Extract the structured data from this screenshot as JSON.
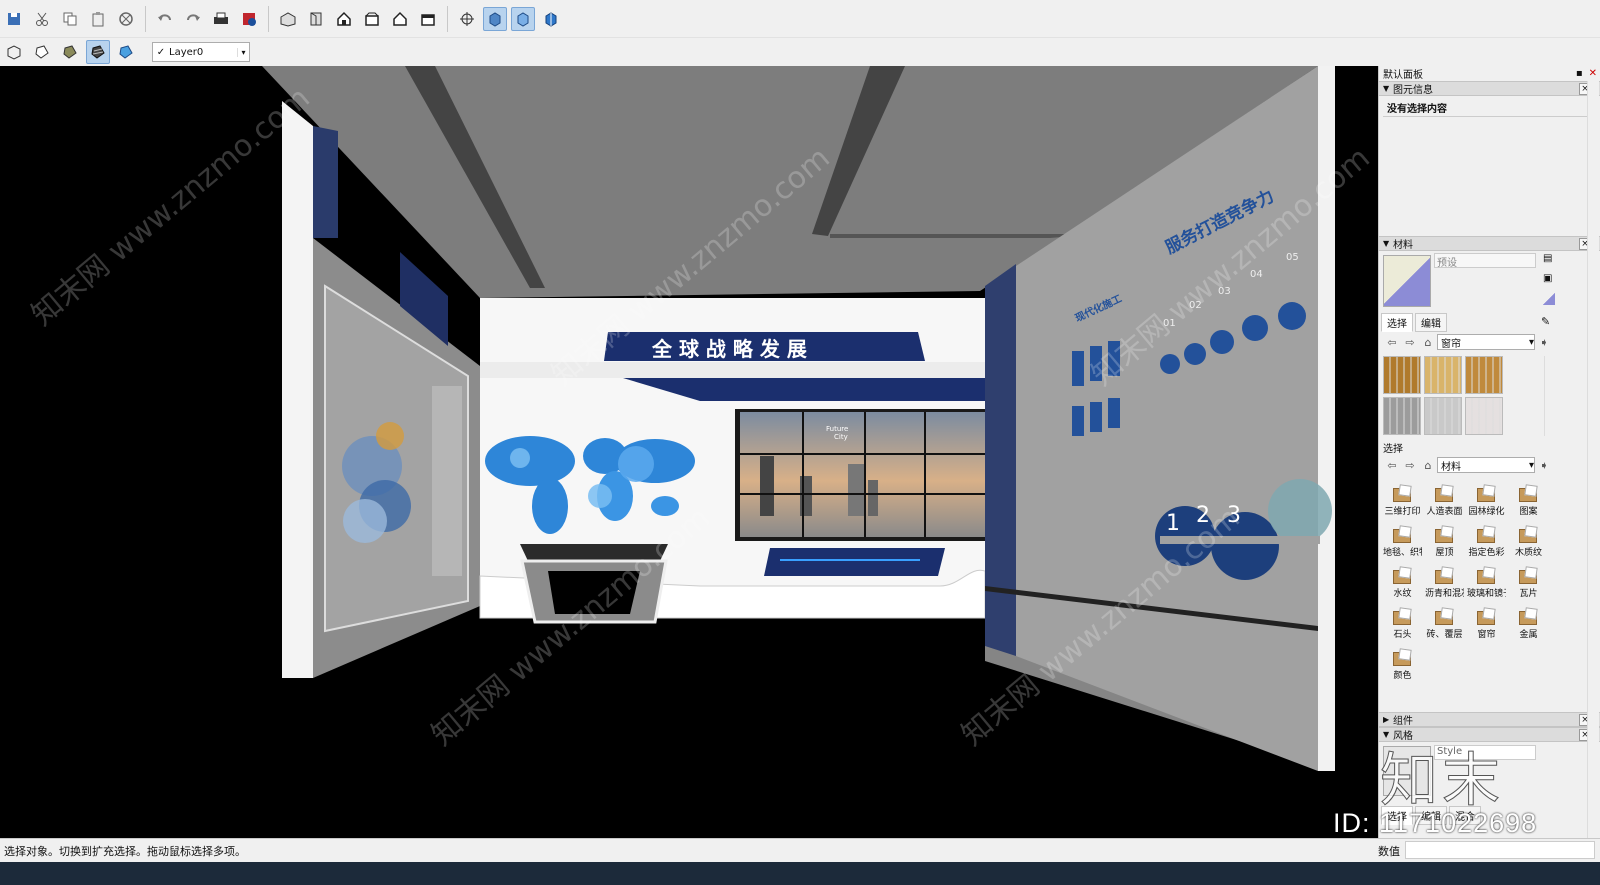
{
  "toolbar": {
    "row1_icons": [
      "save-icon",
      "cut-icon",
      "copy-icon",
      "paste-icon",
      "erase-icon",
      "undo-icon",
      "redo-icon",
      "print-icon",
      "model-info-icon",
      "iso-view-icon",
      "top-view-icon",
      "front-view-icon",
      "right-view-icon",
      "back-view-icon",
      "left-view-icon",
      "perspective-icon",
      "xray-icon",
      "wireframe-icon",
      "hidden-line-icon"
    ],
    "row2_icons": [
      "wireframe-style-icon",
      "hidden-line-style-icon",
      "shaded-icon",
      "shaded-texture-icon",
      "monochrome-icon"
    ],
    "layer_check": "✓",
    "layer_name": "Layer0"
  },
  "scene": {
    "banner_title": "全 球 战 略 发 展",
    "screen_text_1": "Future",
    "screen_text_2": "City",
    "right_wall_title": "服务打造竞争力",
    "right_wall_sub": "现代化施工",
    "steps": [
      "01",
      "02",
      "03",
      "04",
      "05"
    ],
    "ring_numbers": [
      "1",
      "2",
      "3"
    ]
  },
  "tray": {
    "default_tray": "默认面板",
    "entity_info": {
      "title": "图元信息",
      "empty": "没有选择内容"
    },
    "materials": {
      "title": "材料",
      "preset_label": "预设",
      "tab_select": "选择",
      "tab_edit": "编辑",
      "top_dropdown": "窗帘",
      "swatch_colors": [
        "#b07a2c",
        "#d9b46a",
        "#c08a3c",
        "#9c9c9c",
        "#c9c9c9",
        "#e5e0e0"
      ],
      "section_label": "选择",
      "bottom_dropdown": "材料",
      "folders": [
        "三维打印",
        "人造表面",
        "园林绿化",
        "图案",
        "地毯、织物",
        "屋顶",
        "指定色彩",
        "木质纹",
        "水纹",
        "沥青和混凝土",
        "玻璃和镜子",
        "瓦片",
        "石头",
        "砖、覆层",
        "窗帘",
        "金属",
        "颜色"
      ]
    },
    "components": {
      "title": "组件"
    },
    "styles": {
      "title": "风格",
      "style_name": "Style",
      "tabs": [
        "选择",
        "编辑",
        "混合"
      ]
    }
  },
  "watermark": {
    "url": "知末网 www.znzmo.com",
    "id": "ID: 1171022698",
    "logo": "知末"
  },
  "status": {
    "message": "选择对象。切换到扩充选择。拖动鼠标选择多项。",
    "measure_label": "数值"
  }
}
